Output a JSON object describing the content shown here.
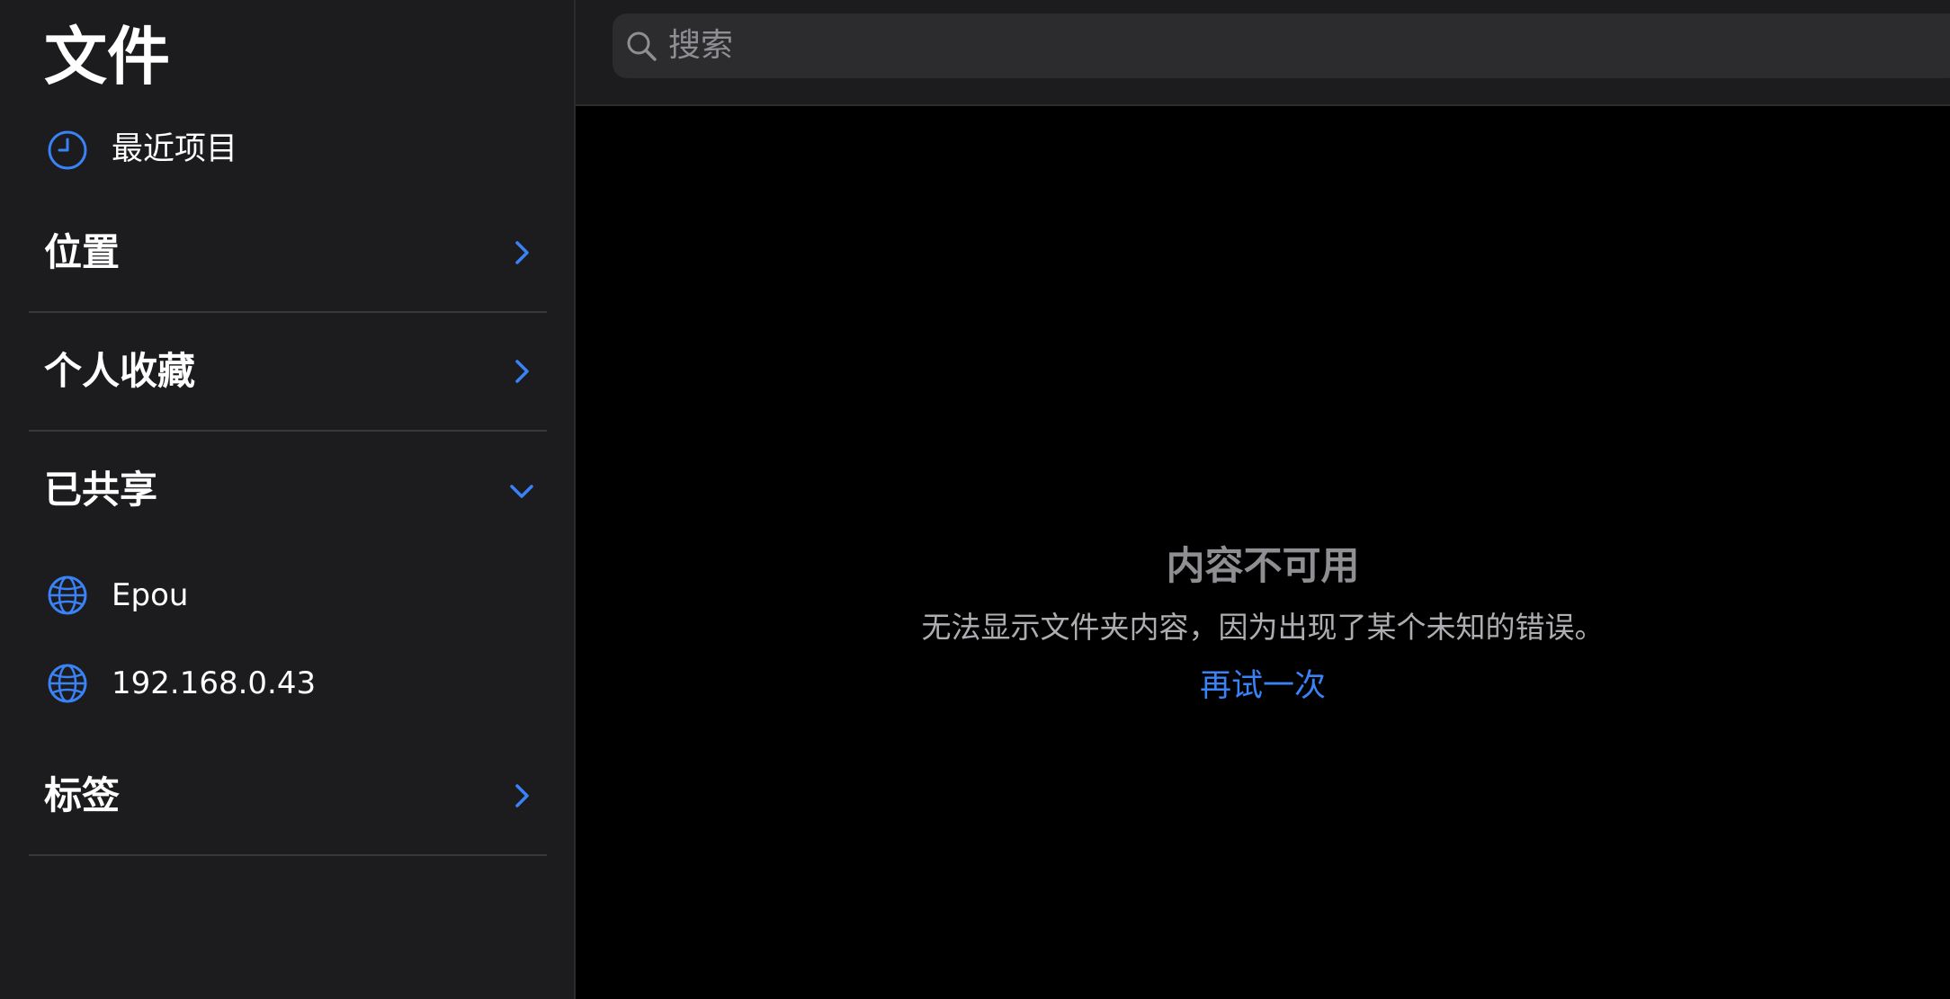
{
  "colors": {
    "accent": "#3a82f7",
    "sidebar_bg": "#1c1c1e",
    "main_bg": "#000000",
    "secondary_text": "#8e8e93"
  },
  "sidebar": {
    "title": "文件",
    "recent": {
      "label": "最近项目",
      "icon": "clock-icon"
    },
    "sections": {
      "locations": {
        "label": "位置",
        "icon": "chevron-right-icon"
      },
      "favorites": {
        "label": "个人收藏",
        "icon": "chevron-right-icon"
      },
      "shared": {
        "label": "已共享",
        "icon": "chevron-down-icon",
        "items": [
          {
            "label": "Epou",
            "icon": "globe-icon"
          },
          {
            "label": "192.168.0.43",
            "icon": "globe-icon"
          }
        ]
      },
      "tags": {
        "label": "标签",
        "icon": "chevron-right-icon"
      }
    }
  },
  "search": {
    "placeholder": "搜索",
    "icon": "search-icon"
  },
  "empty_state": {
    "title": "内容不可用",
    "message": "无法显示文件夹内容，因为出现了某个未知的错误。",
    "retry_label": "再试一次"
  }
}
